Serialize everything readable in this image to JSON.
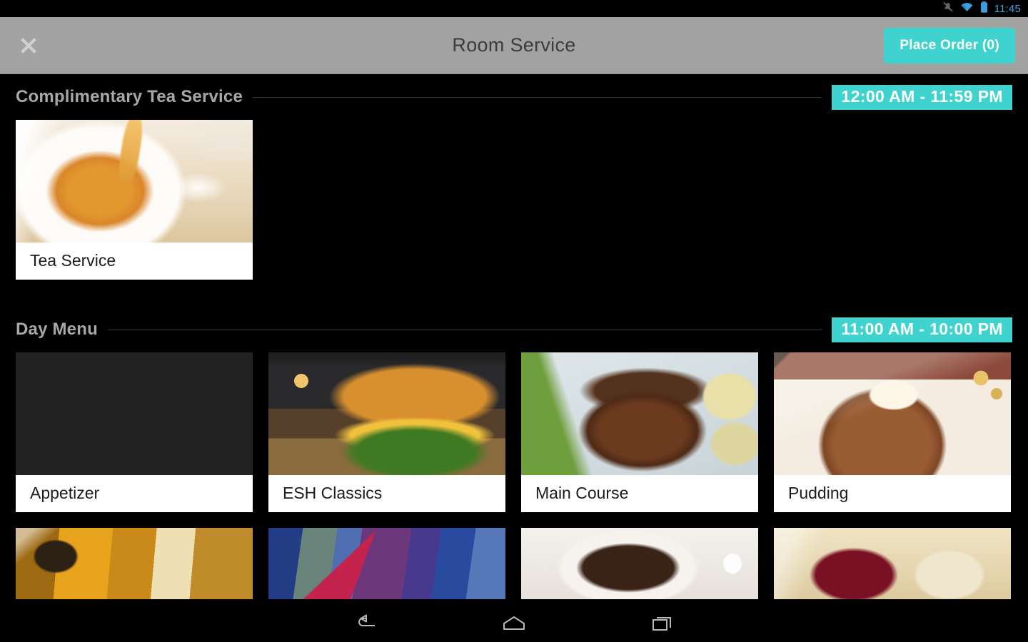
{
  "statusbar": {
    "time": "11:45",
    "icons": [
      "silent-mode-icon",
      "wifi-icon",
      "battery-icon"
    ]
  },
  "appbar": {
    "close_icon": "close-icon",
    "title": "Room Service",
    "place_order_label": "Place Order (0)"
  },
  "colors": {
    "accent_teal": "#3fd3cf",
    "header_gray": "#a2a2a2",
    "background": "#000000",
    "section_title": "#a8a8a8",
    "status_blue": "#3d9fdc"
  },
  "sections": [
    {
      "title": "Complimentary Tea Service",
      "hours": "12:00 AM - 11:59 PM",
      "cards": [
        {
          "label": "Tea Service",
          "image": "tea-pouring-into-cup"
        }
      ]
    },
    {
      "title": "Day Menu",
      "hours": "11:00 AM - 10:00 PM",
      "cards": [
        {
          "label": "Appetizer",
          "image": "cheese-and-grapes"
        },
        {
          "label": "ESH Classics",
          "image": "cheeseburger-with-fries"
        },
        {
          "label": "Main Course",
          "image": "steak-with-asparagus"
        },
        {
          "label": "Pudding",
          "image": "chocolate-mousse-cake"
        }
      ],
      "partial_cards": [
        {
          "image": "soft-drinks-with-ice"
        },
        {
          "image": "colorful-cocktails"
        },
        {
          "image": "cup-of-coffee"
        },
        {
          "image": "red-and-white-wine"
        }
      ]
    }
  ],
  "navbar": {
    "back_label": "back-icon",
    "home_label": "home-icon",
    "recents_label": "recents-icon"
  }
}
